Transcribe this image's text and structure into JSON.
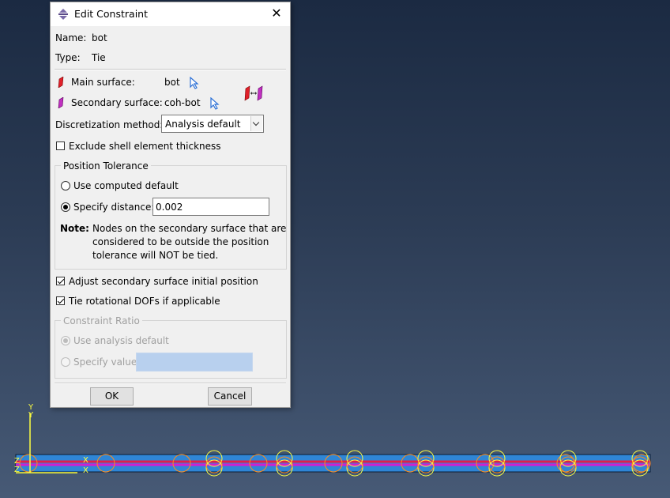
{
  "dialog": {
    "title": "Edit Constraint",
    "name_label": "Name:",
    "name_value": "bot",
    "type_label": "Type:",
    "type_value": "Tie",
    "main_surface_label": "Main surface:",
    "main_surface_value": "bot",
    "secondary_surface_label": "Secondary surface:",
    "secondary_surface_value": "coh-bot",
    "discretization_label": "Discretization method:",
    "discretization_value": "Analysis default",
    "exclude_shell_label": "Exclude shell element thickness",
    "exclude_shell_checked": false,
    "position_tolerance": {
      "title": "Position Tolerance",
      "use_computed_label": "Use computed default",
      "specify_distance_label": "Specify distance:",
      "specify_distance_value": "0.002",
      "selected": "specify_distance",
      "note_label": "Note:",
      "note_line1": "Nodes on the secondary surface that are",
      "note_line2": "considered to be outside the position",
      "note_line3": "tolerance will NOT be tied."
    },
    "adjust_secondary_label": "Adjust secondary surface initial position",
    "adjust_secondary_checked": true,
    "tie_rotational_label": "Tie rotational DOFs if applicable",
    "tie_rotational_checked": true,
    "constraint_ratio": {
      "title": "Constraint Ratio",
      "use_analysis_default_label": "Use analysis default",
      "specify_value_label": "Specify value",
      "enabled": false
    },
    "ok_label": "OK",
    "cancel_label": "Cancel"
  },
  "icons": {
    "title_icon": "tie-constraint-icon",
    "close_icon": "close-icon",
    "main_surface_icon": "red-surface-icon",
    "secondary_surface_icon": "magenta-surface-icon",
    "select_pointer_icon": "select-arrow-icon",
    "swap_surfaces_icon": "swap-surfaces-icon"
  },
  "viewport": {
    "triad_labels": [
      "Y",
      "Z",
      "X"
    ],
    "colors": {
      "background_top": "#1b2a42",
      "background_bottom": "#475a76",
      "part_blue": "#2f86d6",
      "main_surface_red": "#e0204a",
      "secondary_surface_magenta": "#d020d0",
      "constraint_markers_orange": "#ff8c1a",
      "constraint_markers_yellow": "#ffff40"
    }
  }
}
